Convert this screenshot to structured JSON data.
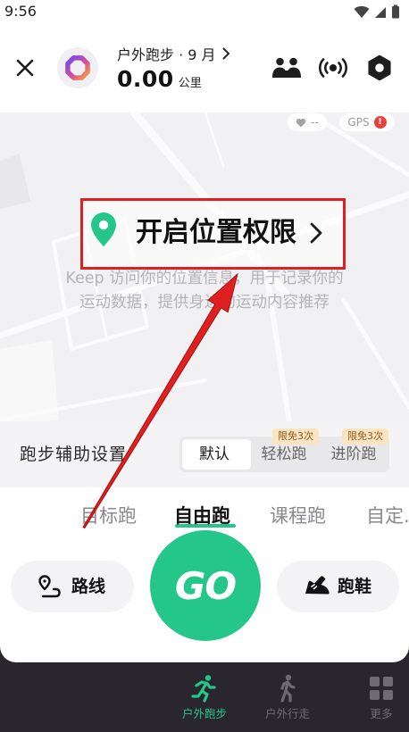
{
  "status_bar": {
    "time": "9:56",
    "icons": [
      "wifi-icon",
      "signal-icon",
      "battery-icon"
    ]
  },
  "header": {
    "close_icon": "close-icon",
    "logo_icon": "ring-logo-icon",
    "title": "户外跑步 · 9 月",
    "distance_value": "0.00",
    "distance_unit": "公里",
    "actions": [
      "group-run-icon",
      "broadcast-icon",
      "settings-hexagon-icon"
    ]
  },
  "map": {
    "heart_rate": "--",
    "gps_label": "GPS",
    "gps_alert": "!",
    "permission_title": "开启位置权限",
    "permission_desc_line1": "Keep 访问你的位置信息，用于记录你的",
    "permission_desc_line2": "运动数据，提供身边的运动内容推荐"
  },
  "run_assist": {
    "label": "跑步辅助设置",
    "options": [
      {
        "label": "默认",
        "selected": true
      },
      {
        "label": "轻松跑",
        "badge": "限免3次",
        "selected": false
      },
      {
        "label": "进阶跑",
        "badge": "限免3次",
        "selected": false
      }
    ]
  },
  "mode_tabs": [
    {
      "label": "目标跑",
      "selected": false
    },
    {
      "label": "自由跑",
      "selected": true
    },
    {
      "label": "课程跑",
      "selected": false
    },
    {
      "label": "自定.",
      "selected": false
    }
  ],
  "actions": {
    "route_label": "路线",
    "route_icon": "route-icon",
    "go_label": "GO",
    "shoes_label": "跑鞋",
    "shoes_icon": "shoe-icon"
  },
  "bottom_nav": [
    {
      "label": "户外跑步",
      "icon": "running-icon",
      "active": true
    },
    {
      "label": "户外行走",
      "icon": "walking-icon",
      "active": false
    },
    {
      "label": "更多",
      "icon": "grid-icon",
      "active": false
    }
  ],
  "colors": {
    "accent": "#24c789",
    "nav_bg": "#2a262e",
    "annotation": "#e02020",
    "badge_bg": "#fde4c0",
    "alert": "#e8413c"
  }
}
